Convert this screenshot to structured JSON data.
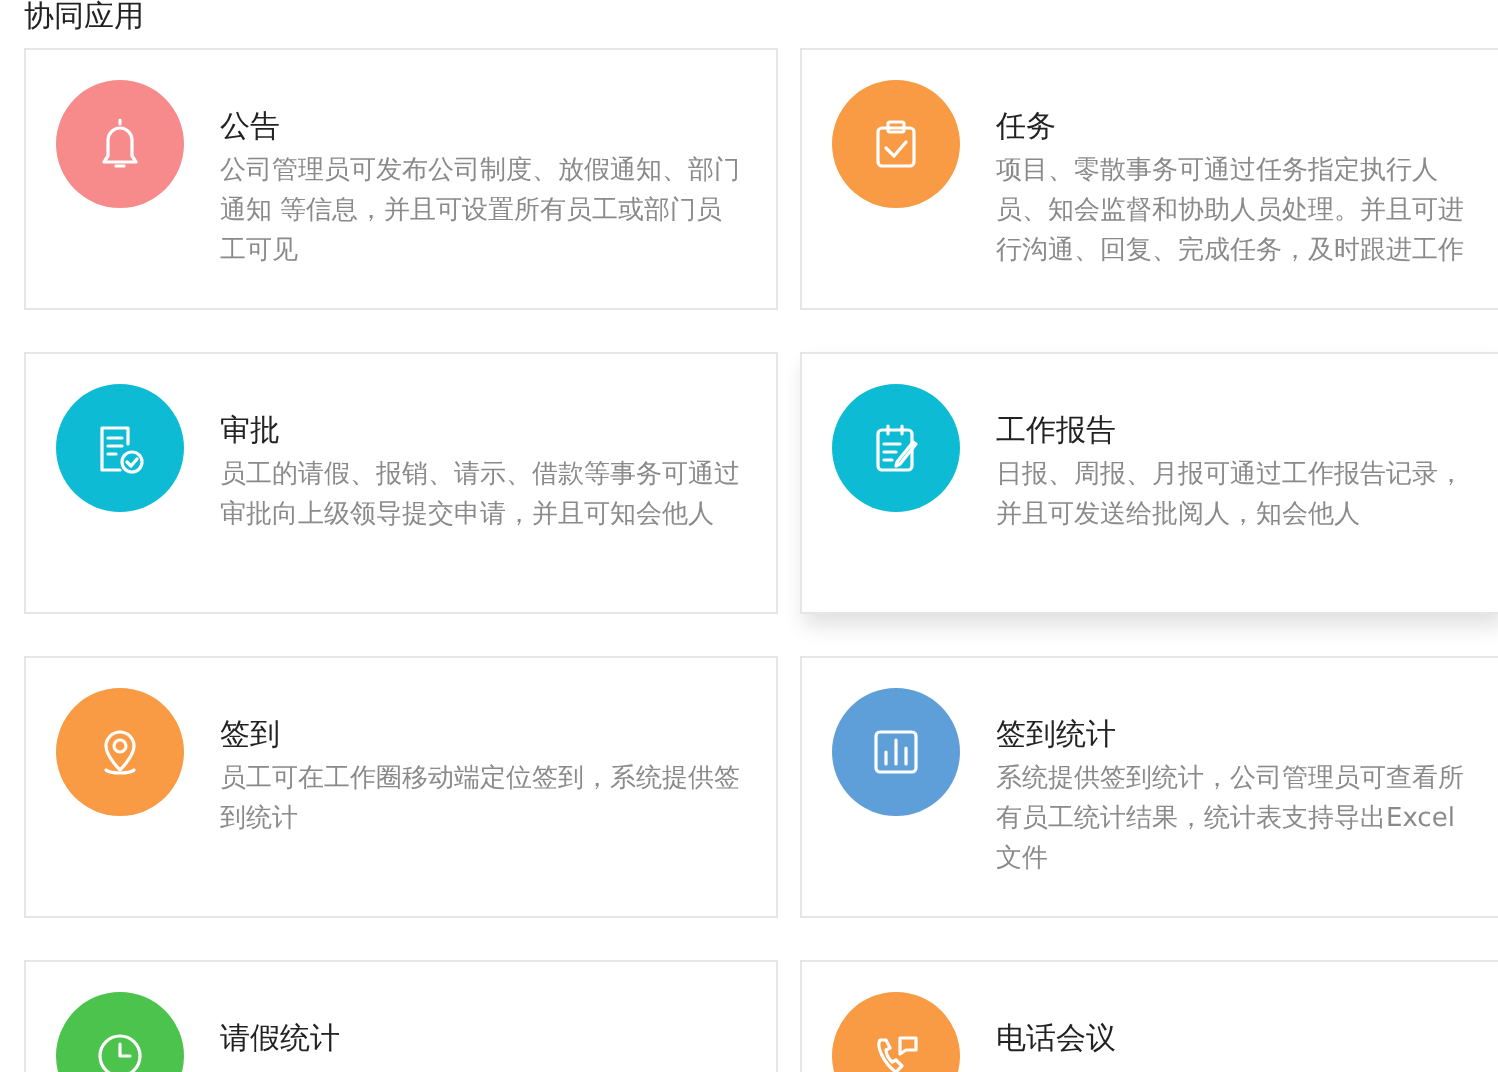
{
  "section_title": "协同应用",
  "apps": [
    {
      "kind": "bell",
      "color": "#f78b8b",
      "title": "公告",
      "description": "公司管理员可发布公司制度、放假通知、部门通知 等信息，并且可设置所有员工或部门员工可见",
      "raised": false
    },
    {
      "kind": "task",
      "color": "#f99a45",
      "title": "任务",
      "description": "项目、零散事务可通过任务指定执行人员、知会监督和协助人员处理。并且可进行沟通、回复、完成任务，及时跟进工作",
      "raised": false
    },
    {
      "kind": "approval",
      "color": "#0dbbd4",
      "title": "审批",
      "description": "员工的请假、报销、请示、借款等事务可通过审批向上级领导提交申请，并且可知会他人",
      "raised": false
    },
    {
      "kind": "report",
      "color": "#0dbbd4",
      "title": "工作报告",
      "description": "日报、周报、月报可通过工作报告记录，并且可发送给批阅人，知会他人",
      "raised": true
    },
    {
      "kind": "location",
      "color": "#f99a45",
      "title": "签到",
      "description": "员工可在工作圈移动端定位签到，系统提供签到统计",
      "raised": false
    },
    {
      "kind": "chart",
      "color": "#5f9fd9",
      "title": "签到统计",
      "description": "系统提供签到统计，公司管理员可查看所有员工统计结果，统计表支持导出Excel文件",
      "raised": false
    },
    {
      "kind": "clock",
      "color": "#4cc34c",
      "title": "请假统计"
    },
    {
      "kind": "phone",
      "color": "#f99a45",
      "title": "电话会议"
    }
  ]
}
